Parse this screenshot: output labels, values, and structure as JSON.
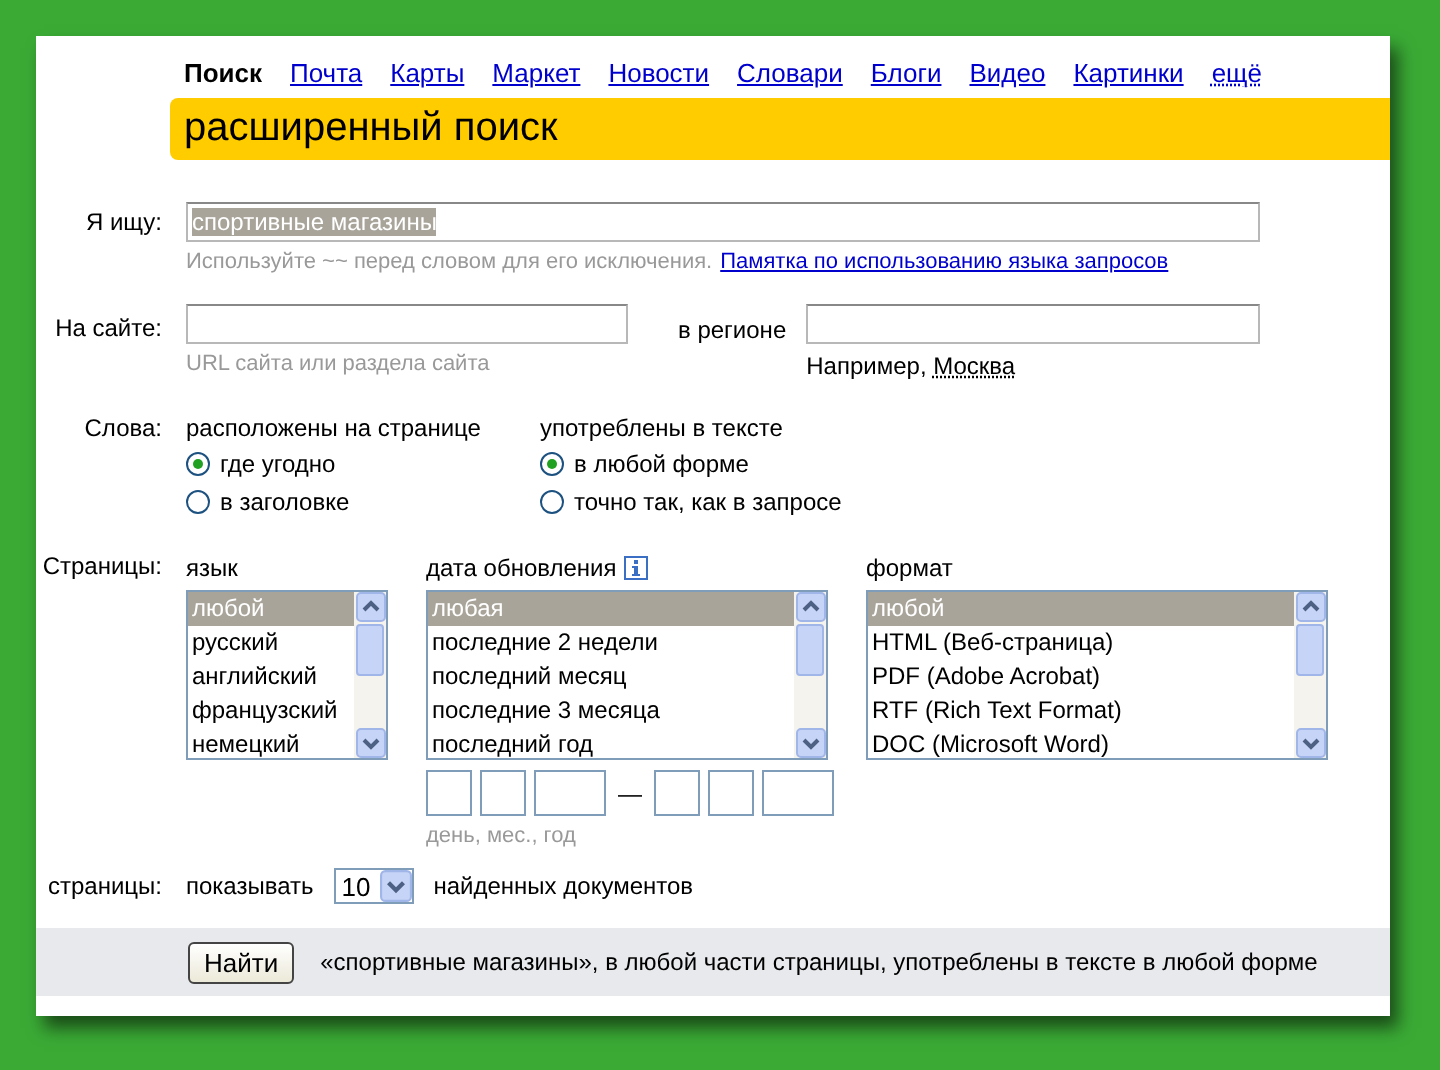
{
  "nav": [
    {
      "label": "Поиск",
      "selected": true
    },
    {
      "label": "Почта",
      "selected": false
    },
    {
      "label": "Карты",
      "selected": false
    },
    {
      "label": "Маркет",
      "selected": false
    },
    {
      "label": "Новости",
      "selected": false
    },
    {
      "label": "Словари",
      "selected": false
    },
    {
      "label": "Блоги",
      "selected": false
    },
    {
      "label": "Видео",
      "selected": false
    },
    {
      "label": "Картинки",
      "selected": false
    },
    {
      "label": "ещё",
      "selected": false,
      "kind": "more"
    }
  ],
  "title": "расширенный поиск",
  "query": {
    "label": "Я ищу:",
    "value": "спортивные магазины",
    "hint": "Используйте ~~ перед словом для его исключения.",
    "help_link": "Памятка по использованию языка запросов"
  },
  "site": {
    "label": "На сайте:",
    "hint": "URL сайта или раздела сайта",
    "region_label": "в регионе",
    "example_prefix": "Например,",
    "example_link": "Москва"
  },
  "words": {
    "label": "Слова:",
    "groups": [
      {
        "title": "расположены на странице",
        "options": [
          {
            "label": "где угодно",
            "selected": true
          },
          {
            "label": "в заголовке",
            "selected": false
          }
        ]
      },
      {
        "title": "употреблены в тексте",
        "options": [
          {
            "label": "в любой форме",
            "selected": true
          },
          {
            "label": "точно так, как в запросе",
            "selected": false
          }
        ]
      }
    ]
  },
  "pages": {
    "label": "Страницы:",
    "lists": [
      {
        "title": "язык",
        "info": false,
        "kind": "narrow",
        "items": [
          {
            "label": "любой",
            "selected": true
          },
          {
            "label": "русский",
            "selected": false
          },
          {
            "label": "английский",
            "selected": false
          },
          {
            "label": "французский",
            "selected": false
          },
          {
            "label": "немецкий",
            "selected": false
          }
        ]
      },
      {
        "title": "дата обновления",
        "info": true,
        "kind": "date",
        "items": [
          {
            "label": "любая",
            "selected": true
          },
          {
            "label": "последние 2 недели",
            "selected": false
          },
          {
            "label": "последний месяц",
            "selected": false
          },
          {
            "label": "последние 3 месяца",
            "selected": false
          },
          {
            "label": "последний год",
            "selected": false
          }
        ]
      },
      {
        "title": "формат",
        "info": false,
        "kind": "wide",
        "items": [
          {
            "label": "любой",
            "selected": true
          },
          {
            "label": "HTML (Веб-страница)",
            "selected": false
          },
          {
            "label": "PDF (Adobe Acrobat)",
            "selected": false
          },
          {
            "label": "RTF (Rich Text Format)",
            "selected": false
          },
          {
            "label": "DOC (Microsoft Word)",
            "selected": false
          }
        ]
      }
    ],
    "date_separator": "—",
    "date_hint": "день, мес., год"
  },
  "results": {
    "label": "страницы:",
    "prefix": "показывать",
    "count": "10",
    "suffix": "найденных документов"
  },
  "footer": {
    "button": "Найти",
    "summary": "«спортивные магазины», в любой части страницы, употреблены в тексте в любой форме"
  }
}
